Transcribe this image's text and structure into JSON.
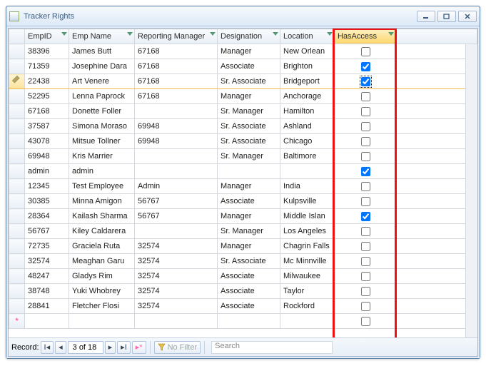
{
  "window": {
    "title": "Tracker Rights"
  },
  "columns": {
    "empid": "EmpID",
    "empname": "Emp Name",
    "manager": "Reporting Manager",
    "designation": "Designation",
    "location": "Location",
    "hasaccess": "HasAccess"
  },
  "rows": [
    {
      "empid": "38396",
      "name": "James Butt",
      "mgr": "67168",
      "des": "Manager",
      "loc": "New Orlean",
      "access": false
    },
    {
      "empid": "71359",
      "name": "Josephine Dara",
      "mgr": "67168",
      "des": "Associate",
      "loc": "Brighton",
      "access": true
    },
    {
      "empid": "22438",
      "name": "Art Venere",
      "mgr": "67168",
      "des": "Sr. Associate",
      "loc": "Bridgeport",
      "access": true,
      "editing": true
    },
    {
      "empid": "52295",
      "name": "Lenna Paprock",
      "mgr": "67168",
      "des": "Manager",
      "loc": "Anchorage",
      "access": false
    },
    {
      "empid": "67168",
      "name": "Donette Foller",
      "mgr": "",
      "des": "Sr. Manager",
      "loc": "Hamilton",
      "access": false
    },
    {
      "empid": "37587",
      "name": "Simona Moraso",
      "mgr": "69948",
      "des": "Sr. Associate",
      "loc": "Ashland",
      "access": false
    },
    {
      "empid": "43078",
      "name": "Mitsue Tollner",
      "mgr": "69948",
      "des": "Sr. Associate",
      "loc": "Chicago",
      "access": false
    },
    {
      "empid": "69948",
      "name": "Kris Marrier",
      "mgr": "",
      "des": "Sr. Manager",
      "loc": "Baltimore",
      "access": false
    },
    {
      "empid": "admin",
      "name": "admin",
      "mgr": "",
      "des": "",
      "loc": "",
      "access": true
    },
    {
      "empid": "12345",
      "name": "Test Employee",
      "mgr": "Admin",
      "des": "Manager",
      "loc": "India",
      "access": false
    },
    {
      "empid": "30385",
      "name": "Minna Amigon",
      "mgr": "56767",
      "des": "Associate",
      "loc": "Kulpsville",
      "access": false
    },
    {
      "empid": "28364",
      "name": "Kailash Sharma",
      "mgr": "56767",
      "des": "Manager",
      "loc": "Middle Islan",
      "access": true
    },
    {
      "empid": "56767",
      "name": "Kiley Caldarera",
      "mgr": "",
      "des": "Sr. Manager",
      "loc": "Los Angeles",
      "access": false
    },
    {
      "empid": "72735",
      "name": "Graciela Ruta",
      "mgr": "32574",
      "des": "Manager",
      "loc": "Chagrin Falls",
      "access": false
    },
    {
      "empid": "32574",
      "name": "Meaghan Garu",
      "mgr": "32574",
      "des": "Sr. Associate",
      "loc": "Mc Minnville",
      "access": false
    },
    {
      "empid": "48247",
      "name": "Gladys Rim",
      "mgr": "32574",
      "des": "Associate",
      "loc": "Milwaukee",
      "access": false
    },
    {
      "empid": "38748",
      "name": "Yuki Whobrey",
      "mgr": "32574",
      "des": "Associate",
      "loc": "Taylor",
      "access": false
    },
    {
      "empid": "28841",
      "name": "Fletcher Flosi",
      "mgr": "32574",
      "des": "Associate",
      "loc": "Rockford",
      "access": false
    }
  ],
  "nav": {
    "label": "Record:",
    "position": "3 of 18",
    "nofilter": "No Filter",
    "search": "Search"
  }
}
